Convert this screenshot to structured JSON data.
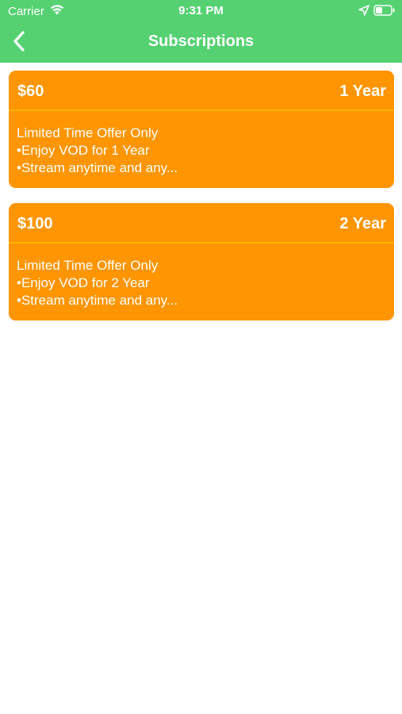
{
  "status_bar": {
    "carrier": "Carrier",
    "time": "9:31 PM",
    "icons": [
      "wifi-icon",
      "location-arrow-icon",
      "battery-icon"
    ]
  },
  "nav": {
    "title": "Subscriptions",
    "back_icon": "chevron-left-icon"
  },
  "colors": {
    "header": "#55d172",
    "card": "#ff9500",
    "divider": "#ffb400",
    "text": "#ffffff"
  },
  "plans": [
    {
      "price": "$60",
      "duration": "1 Year",
      "lines": [
        "Limited Time Offer Only",
        "•Enjoy VOD for 1 Year",
        "•Stream anytime and any..."
      ]
    },
    {
      "price": "$100",
      "duration": "2 Year",
      "lines": [
        "Limited Time Offer Only",
        "•Enjoy VOD for 2 Year",
        "•Stream anytime and any..."
      ]
    }
  ]
}
